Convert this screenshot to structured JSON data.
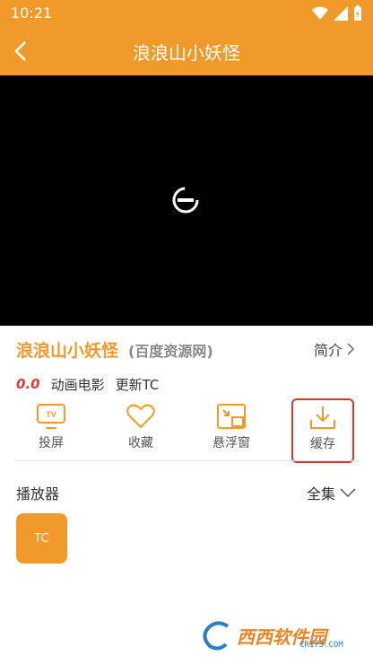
{
  "status_bar": {
    "time": "10:21"
  },
  "header": {
    "title": "浪浪山小妖怪"
  },
  "info": {
    "title": "浪浪山小妖怪",
    "source": "(百度资源网)",
    "intro_label": "简介"
  },
  "meta": {
    "score": "0.0",
    "category": "动画电影",
    "update": "更新TC"
  },
  "actions": [
    {
      "label": "投屏",
      "icon": "tv-cast-icon"
    },
    {
      "label": "收藏",
      "icon": "heart-icon"
    },
    {
      "label": "悬浮窗",
      "icon": "pip-icon"
    },
    {
      "label": "缓存",
      "icon": "download-icon",
      "highlighted": true
    }
  ],
  "player_section": {
    "label": "播放器",
    "all_label": "全集",
    "episodes": [
      "TC"
    ]
  },
  "watermark": {
    "text": "西西软件园",
    "sub": "CR173.COM"
  },
  "colors": {
    "accent": "#ef9a2a",
    "score": "#e23b3b",
    "highlight_border": "#d9382f"
  }
}
